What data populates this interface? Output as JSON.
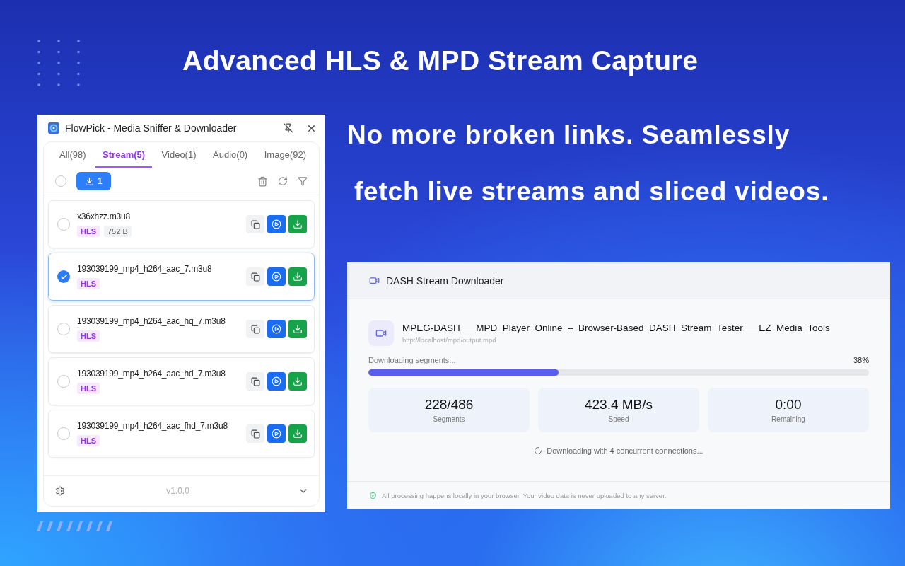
{
  "headline": "Advanced HLS & MPD Stream Capture",
  "tagline": [
    "No more broken links. Seamlessly",
    "fetch live streams and sliced videos."
  ],
  "extension": {
    "title": "FlowPick - Media Sniffer & Downloader",
    "tabs": [
      {
        "label": "All(98)",
        "selected": false
      },
      {
        "label": "Stream(5)",
        "selected": true
      },
      {
        "label": "Video(1)",
        "selected": false
      },
      {
        "label": "Audio(0)",
        "selected": false
      },
      {
        "label": "Image(92)",
        "selected": false
      }
    ],
    "toolbar": {
      "select_all_checked": false,
      "download_count": "1"
    },
    "items": [
      {
        "name": "x36xhzz.m3u8",
        "checked": false,
        "tags": [
          {
            "kind": "format",
            "label": "HLS"
          },
          {
            "kind": "size",
            "label": "752 B"
          }
        ]
      },
      {
        "name": "193039199_mp4_h264_aac_7.m3u8",
        "checked": true,
        "tags": [
          {
            "kind": "format",
            "label": "HLS"
          }
        ]
      },
      {
        "name": "193039199_mp4_h264_aac_hq_7.m3u8",
        "checked": false,
        "tags": [
          {
            "kind": "format",
            "label": "HLS"
          }
        ]
      },
      {
        "name": "193039199_mp4_h264_aac_hd_7.m3u8",
        "checked": false,
        "tags": [
          {
            "kind": "format",
            "label": "HLS"
          }
        ]
      },
      {
        "name": "193039199_mp4_h264_aac_fhd_7.m3u8",
        "checked": false,
        "tags": [
          {
            "kind": "format",
            "label": "HLS"
          }
        ]
      }
    ],
    "version": "v1.0.0"
  },
  "downloader": {
    "title": "DASH Stream Downloader",
    "file": {
      "name": "MPEG-DASH___MPD_Player_Online_–_Browser-Based_DASH_Stream_Tester___EZ_Media_Tools",
      "url": "http://localhost/mpd/output.mpd"
    },
    "progress": {
      "label": "Downloading segments...",
      "percent": "38%",
      "level": 0.38
    },
    "stats": [
      {
        "value": "228/486",
        "label": "Segments"
      },
      {
        "value": "423.4 MB/s",
        "label": "Speed"
      },
      {
        "value": "0:00",
        "label": "Remaining"
      }
    ],
    "status": "Downloading with 4 concurrent connections...",
    "notice": "All processing happens locally in your browser. Your video data is never uploaded to any server."
  }
}
